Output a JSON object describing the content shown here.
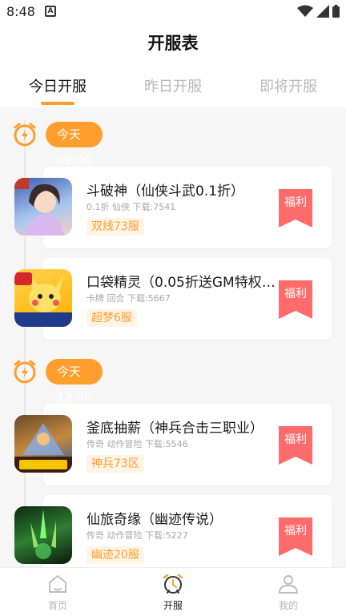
{
  "status_bar": {
    "time": "8:48",
    "notification_letter": "A"
  },
  "header": {
    "title": "开服表"
  },
  "tabs": [
    {
      "label": "今日开服",
      "active": true
    },
    {
      "label": "昨日开服",
      "active": false
    },
    {
      "label": "即将开服",
      "active": false
    }
  ],
  "groups": [
    {
      "time": "今天09:00",
      "games": [
        {
          "title": "斗破神（仙侠斗武0.1折）",
          "meta": "0.1折 仙侠 下载:7541",
          "server": "双线73服",
          "welfare": "福利",
          "icon_text": "0.1折"
        },
        {
          "title": "口袋精灵（0.05折送GM特权…",
          "meta": "卡牌 回合 下载:5667",
          "server": "超梦6服",
          "welfare": "福利",
          "icon_text": "GM特权畅玩"
        }
      ]
    },
    {
      "time": "今天12:00",
      "games": [
        {
          "title": "釜底抽薪（神兵合击三职业）",
          "meta": "传奇 动作冒险 下载:5546",
          "server": "神兵73区",
          "welfare": "福利",
          "icon_text": "狂送真充"
        },
        {
          "title": "仙旅奇缘（幽迹传说）",
          "meta": "传奇 动作冒险 下载:5227",
          "server": "幽迹20服",
          "welfare": "福利",
          "icon_text": ""
        }
      ]
    }
  ],
  "bottom_nav": [
    {
      "label": "首页",
      "icon": "home-icon",
      "active": false
    },
    {
      "label": "开服",
      "icon": "alarm-clock-icon",
      "active": true
    },
    {
      "label": "我的",
      "icon": "user-icon",
      "active": false
    }
  ],
  "colors": {
    "accent": "#ff9e2c",
    "welfare": "#ff6b6b",
    "badge_bg": "#fff4e6"
  }
}
